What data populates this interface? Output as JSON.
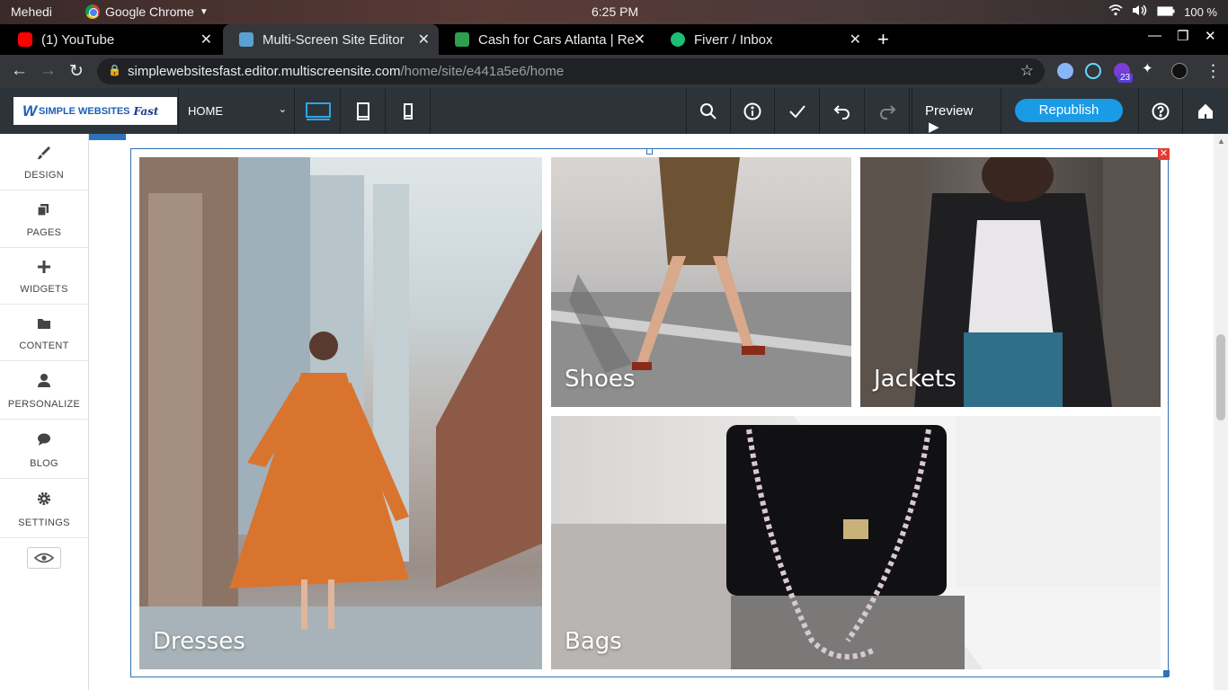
{
  "os": {
    "user": "Mehedi",
    "app": "Google Chrome",
    "time": "6:25 PM",
    "battery": "100 %"
  },
  "tabs": [
    {
      "title": "(1) YouTube",
      "favicon": "youtube-icon",
      "color": "#ff0000"
    },
    {
      "title": "Multi-Screen Site Editor",
      "favicon": "site-editor-icon",
      "color": "#5aa0d0"
    },
    {
      "title": "Cash for Cars Atlanta | Re",
      "favicon": "dollar-icon",
      "color": "#2e9e4f"
    },
    {
      "title": "Fiverr / Inbox",
      "favicon": "fiverr-icon",
      "color": "#1dbf73"
    }
  ],
  "address": {
    "url_host": "simplewebsitesfast.editor.multiscreensite.com",
    "url_path": "/home/site/e441a5e6/home",
    "extension_badge": "23"
  },
  "editor": {
    "logo_text": "SIMPLE WEBSITES",
    "logo_fast": "Fast",
    "page": "HOME",
    "preview_label": "Preview",
    "republish_label": "Republish",
    "accent": "#1a9be6"
  },
  "sidebar": {
    "items": [
      {
        "label": "DESIGN",
        "icon": "brush-icon"
      },
      {
        "label": "PAGES",
        "icon": "pages-icon"
      },
      {
        "label": "WIDGETS",
        "icon": "plus-icon"
      },
      {
        "label": "CONTENT",
        "icon": "folder-icon"
      },
      {
        "label": "PERSONALIZE",
        "icon": "user-icon"
      },
      {
        "label": "BLOG",
        "icon": "chat-icon"
      },
      {
        "label": "SETTINGS",
        "icon": "gear-icon"
      }
    ]
  },
  "gallery": {
    "tiles": [
      {
        "caption": "Dresses"
      },
      {
        "caption": "Shoes"
      },
      {
        "caption": "Jackets"
      },
      {
        "caption": "Bags"
      }
    ]
  }
}
